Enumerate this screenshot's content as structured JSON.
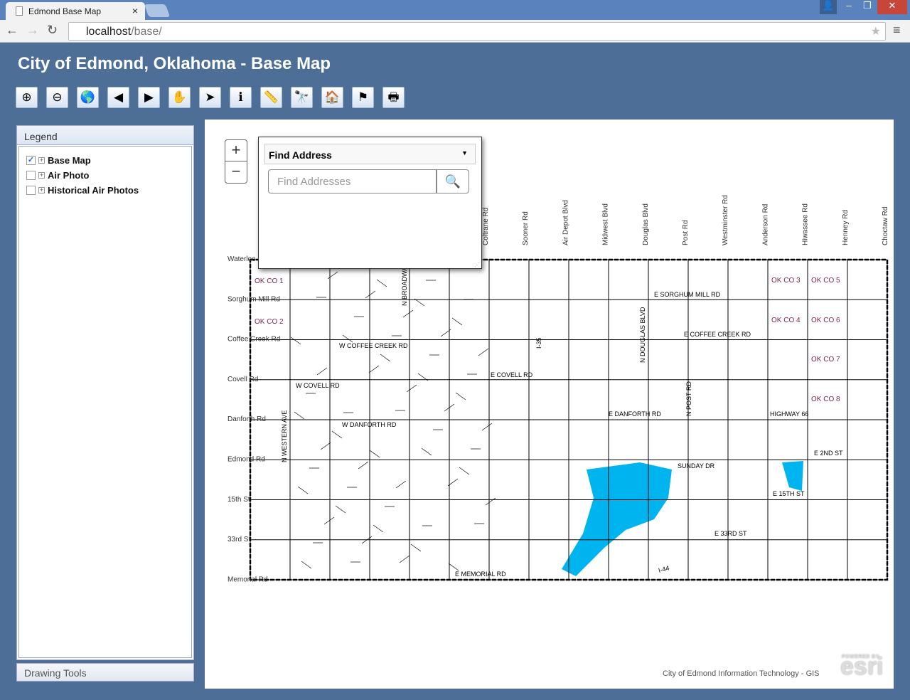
{
  "browser": {
    "tab_title": "Edmond Base Map",
    "url_host": "localhost",
    "url_path": "/base/"
  },
  "header": {
    "title": "City of Edmond, Oklahoma - Base Map"
  },
  "toolbar": [
    {
      "name": "zoom-in",
      "glyph": "⊕"
    },
    {
      "name": "zoom-out",
      "glyph": "⊖"
    },
    {
      "name": "full-extent",
      "glyph": "🌎"
    },
    {
      "name": "previous-extent",
      "glyph": "◀"
    },
    {
      "name": "next-extent",
      "glyph": "▶"
    },
    {
      "name": "pan",
      "glyph": "✋"
    },
    {
      "name": "select",
      "glyph": "➤"
    },
    {
      "name": "identify",
      "glyph": "ℹ"
    },
    {
      "name": "measure",
      "glyph": "📏"
    },
    {
      "name": "find",
      "glyph": "🔭"
    },
    {
      "name": "address-locator",
      "glyph": "🏠"
    },
    {
      "name": "route",
      "glyph": "⚑"
    },
    {
      "name": "print",
      "glyph": "🖶"
    }
  ],
  "legend": {
    "title": "Legend",
    "layers": [
      {
        "label": "Base Map",
        "checked": true
      },
      {
        "label": "Air Photo",
        "checked": false
      },
      {
        "label": "Historical Air Photos",
        "checked": false
      }
    ]
  },
  "drawing_tools": {
    "label": "Drawing Tools"
  },
  "find_widget": {
    "title": "Find Address",
    "placeholder": "Find Addresses"
  },
  "map": {
    "top_roads": [
      "Coltrane Rd",
      "Sooner Rd",
      "Air Depot Blvd",
      "Midwest Blvd",
      "Douglas Blvd",
      "Post Rd",
      "Westminster Rd",
      "Anderson Rd",
      "Hiwassee Rd",
      "Henney Rd",
      "Choctaw Rd"
    ],
    "left_roads": [
      "Waterloo Rd",
      "Sorghum Mill Rd",
      "Coffee Creek Rd",
      "Covell Rd",
      "Danforth Rd",
      "Edmond Rd",
      "15th St",
      "33rd St",
      "Memorial Rd"
    ],
    "county_labels": [
      "OK CO 1",
      "OK CO 2",
      "OK CO 3",
      "OK CO 4",
      "OK CO 5",
      "OK CO 6",
      "OK CO 7",
      "OK CO 8"
    ],
    "street_labels": [
      "E SORGHUM MILL RD",
      "E COFFEE CREEK RD",
      "W COFFEE CREEK RD",
      "E COVELL RD",
      "W COVELL RD",
      "E DANFORTH RD",
      "W DANFORTH RD",
      "E 2ND ST",
      "E 15TH ST",
      "E 33RD ST",
      "E MEMORIAL RD",
      "SUNDAY DR",
      "HIGHWAY 66",
      "N WESTERN AVE",
      "N BROADWAY",
      "N POST RD",
      "N DOUGLAS BLVD",
      "I-35",
      "I-44"
    ],
    "water_color": "#00b4f0",
    "road_color": "#000000",
    "section_label_color": "#7a1f4a"
  },
  "attribution": {
    "text": "City of Edmond Information Technology - GIS",
    "esri": "esri",
    "esri_powered": "POWERED BY"
  }
}
